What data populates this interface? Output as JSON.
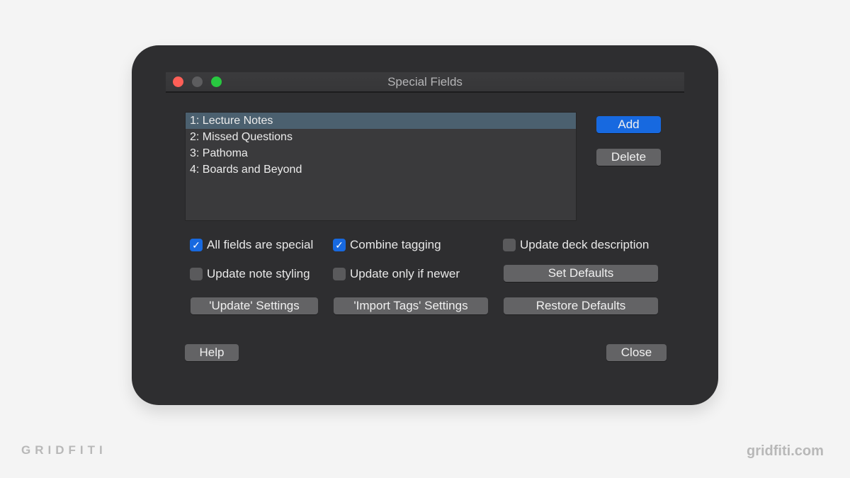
{
  "window": {
    "title": "Special Fields",
    "traffic_lights": [
      "close",
      "minimize",
      "zoom"
    ]
  },
  "fields_list": {
    "items": [
      {
        "label": "1: Lecture Notes",
        "selected": true
      },
      {
        "label": "2: Missed Questions",
        "selected": false
      },
      {
        "label": "3: Pathoma",
        "selected": false
      },
      {
        "label": "4: Boards and Beyond",
        "selected": false
      }
    ]
  },
  "side_buttons": {
    "add": "Add",
    "delete": "Delete"
  },
  "options": {
    "all_fields_special": {
      "label": "All fields are special",
      "checked": true
    },
    "combine_tagging": {
      "label": "Combine tagging",
      "checked": true
    },
    "update_deck_description": {
      "label": "Update deck description",
      "checked": false
    },
    "update_note_styling": {
      "label": "Update note styling",
      "checked": false
    },
    "update_only_if_newer": {
      "label": "Update only if newer",
      "checked": false
    }
  },
  "buttons": {
    "set_defaults": "Set Defaults",
    "update_settings": "'Update' Settings",
    "import_tags_settings": "'Import Tags' Settings",
    "restore_defaults": "Restore Defaults",
    "help": "Help",
    "close": "Close"
  },
  "watermark": {
    "left": "GRIDFITI",
    "right": "gridfiti.com"
  },
  "colors": {
    "accent": "#1769e0",
    "selection": "#4b606f",
    "window_bg": "#2e2e30"
  }
}
